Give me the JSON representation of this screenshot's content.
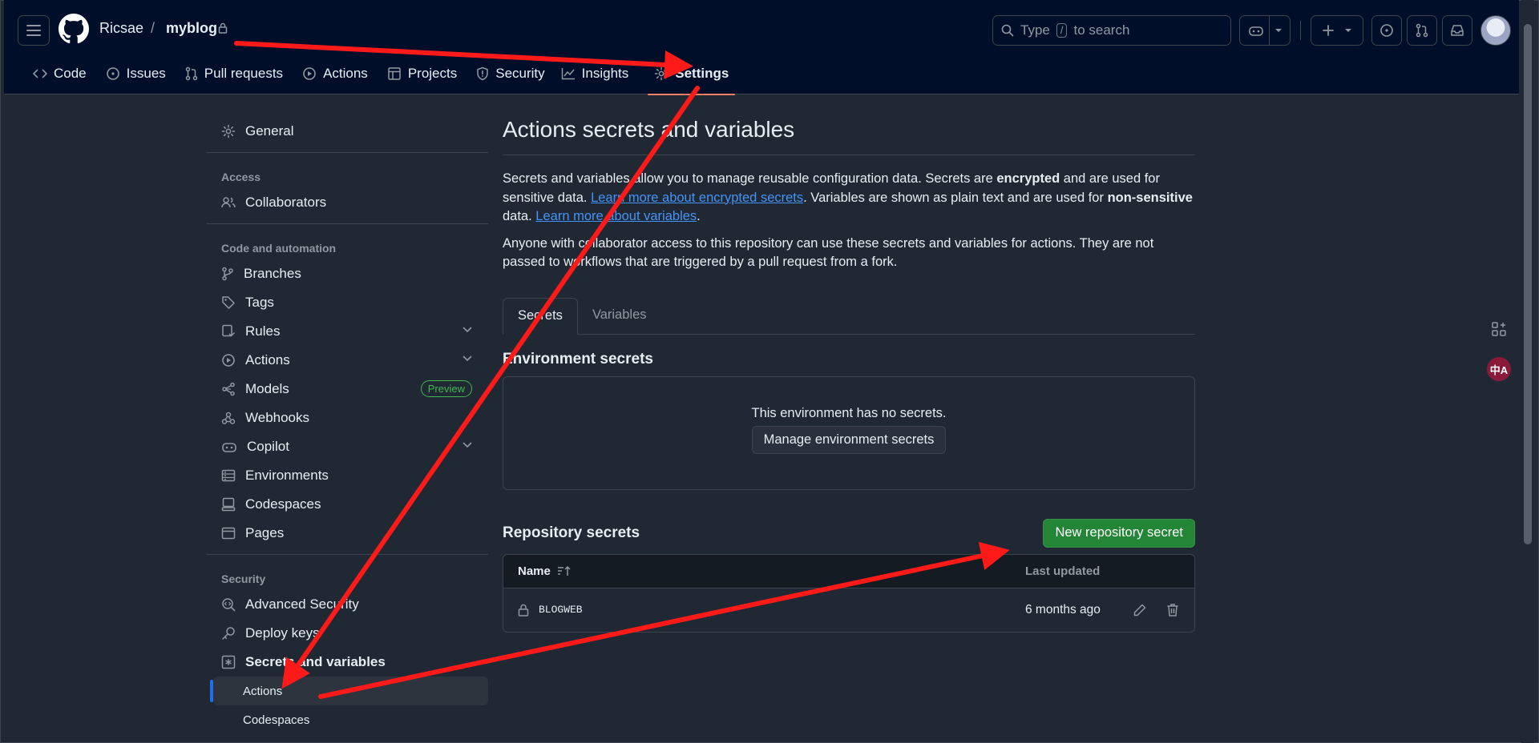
{
  "header": {
    "owner": "Ricsae",
    "separator": "/",
    "repo": "myblog",
    "search_prefix": "Type",
    "search_key": "/",
    "search_suffix": "to search"
  },
  "repo_tabs": [
    {
      "label": "Code",
      "icon": "code-icon"
    },
    {
      "label": "Issues",
      "icon": "issue-icon"
    },
    {
      "label": "Pull requests",
      "icon": "pull-request-icon"
    },
    {
      "label": "Actions",
      "icon": "play-icon"
    },
    {
      "label": "Projects",
      "icon": "table-icon"
    },
    {
      "label": "Security",
      "icon": "shield-icon"
    },
    {
      "label": "Insights",
      "icon": "graph-icon"
    },
    {
      "label": "Settings",
      "icon": "gear-icon",
      "active": true
    }
  ],
  "sidebar": {
    "general": "General",
    "access_heading": "Access",
    "collaborators": "Collaborators",
    "code_heading": "Code and automation",
    "branches": "Branches",
    "tags": "Tags",
    "rules": "Rules",
    "actions": "Actions",
    "models": "Models",
    "models_badge": "Preview",
    "webhooks": "Webhooks",
    "copilot": "Copilot",
    "environments": "Environments",
    "codespaces": "Codespaces",
    "pages": "Pages",
    "security_heading": "Security",
    "advanced_security": "Advanced Security",
    "deploy_keys": "Deploy keys",
    "secrets_vars": "Secrets and variables",
    "sub_actions": "Actions",
    "sub_codespaces": "Codespaces"
  },
  "main": {
    "title": "Actions secrets and variables",
    "p1_a": "Secrets and variables allow you to manage reusable configuration data. Secrets are ",
    "p1_b": "encrypted",
    "p1_c": " and are used for sensitive data. ",
    "p1_link1": "Learn more about encrypted secrets",
    "p1_d": ". Variables are shown as plain text and are used for ",
    "p1_e": "non-sensitive",
    "p1_f": " data. ",
    "p1_link2": "Learn more about variables",
    "p1_g": ".",
    "p2": "Anyone with collaborator access to this repository can use these secrets and variables for actions. They are not passed to workflows that are triggered by a pull request from a fork.",
    "tab_secrets": "Secrets",
    "tab_variables": "Variables",
    "env_title": "Environment secrets",
    "env_empty": "This environment has no secrets.",
    "env_button": "Manage environment secrets",
    "repo_title": "Repository secrets",
    "new_secret_button": "New repository secret",
    "col_name": "Name",
    "col_updated": "Last updated",
    "secrets": [
      {
        "name": "BLOGWEB",
        "updated": "6 months ago"
      }
    ]
  },
  "widgets": {
    "translate_label": "中A"
  },
  "colors": {
    "header_bg": "#010e2a",
    "page_bg": "#202833",
    "accent_link": "#4493f8",
    "green_button": "#238636",
    "annotation_arrow": "#ff1a1a"
  }
}
